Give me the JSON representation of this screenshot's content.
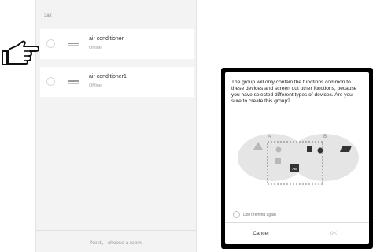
{
  "device_list": {
    "section_label": "3ax",
    "devices": [
      {
        "name": "air conditioner",
        "status": "Offline"
      },
      {
        "name": "air conditioner1",
        "status": "Offline"
      }
    ],
    "footer_label": "Next， choose a room"
  },
  "dialog": {
    "message": "The group will only contain the functions common to these devices and screen out other functions, because you have selected different types of devices. Are you sure to create this group?",
    "diagram": {
      "label_a": "A",
      "label_b": "B",
      "label_ab": "AB"
    },
    "checkbox_label": "Don't remind again",
    "cancel_label": "Cancel",
    "ok_label": "OK"
  },
  "colors": {
    "page_background": "#f3f3f3",
    "set_fill": "#e5e5e5",
    "shape_gray": "#b8b8b8",
    "shape_dark": "#333333",
    "disabled_text": "#c0c0c0"
  }
}
